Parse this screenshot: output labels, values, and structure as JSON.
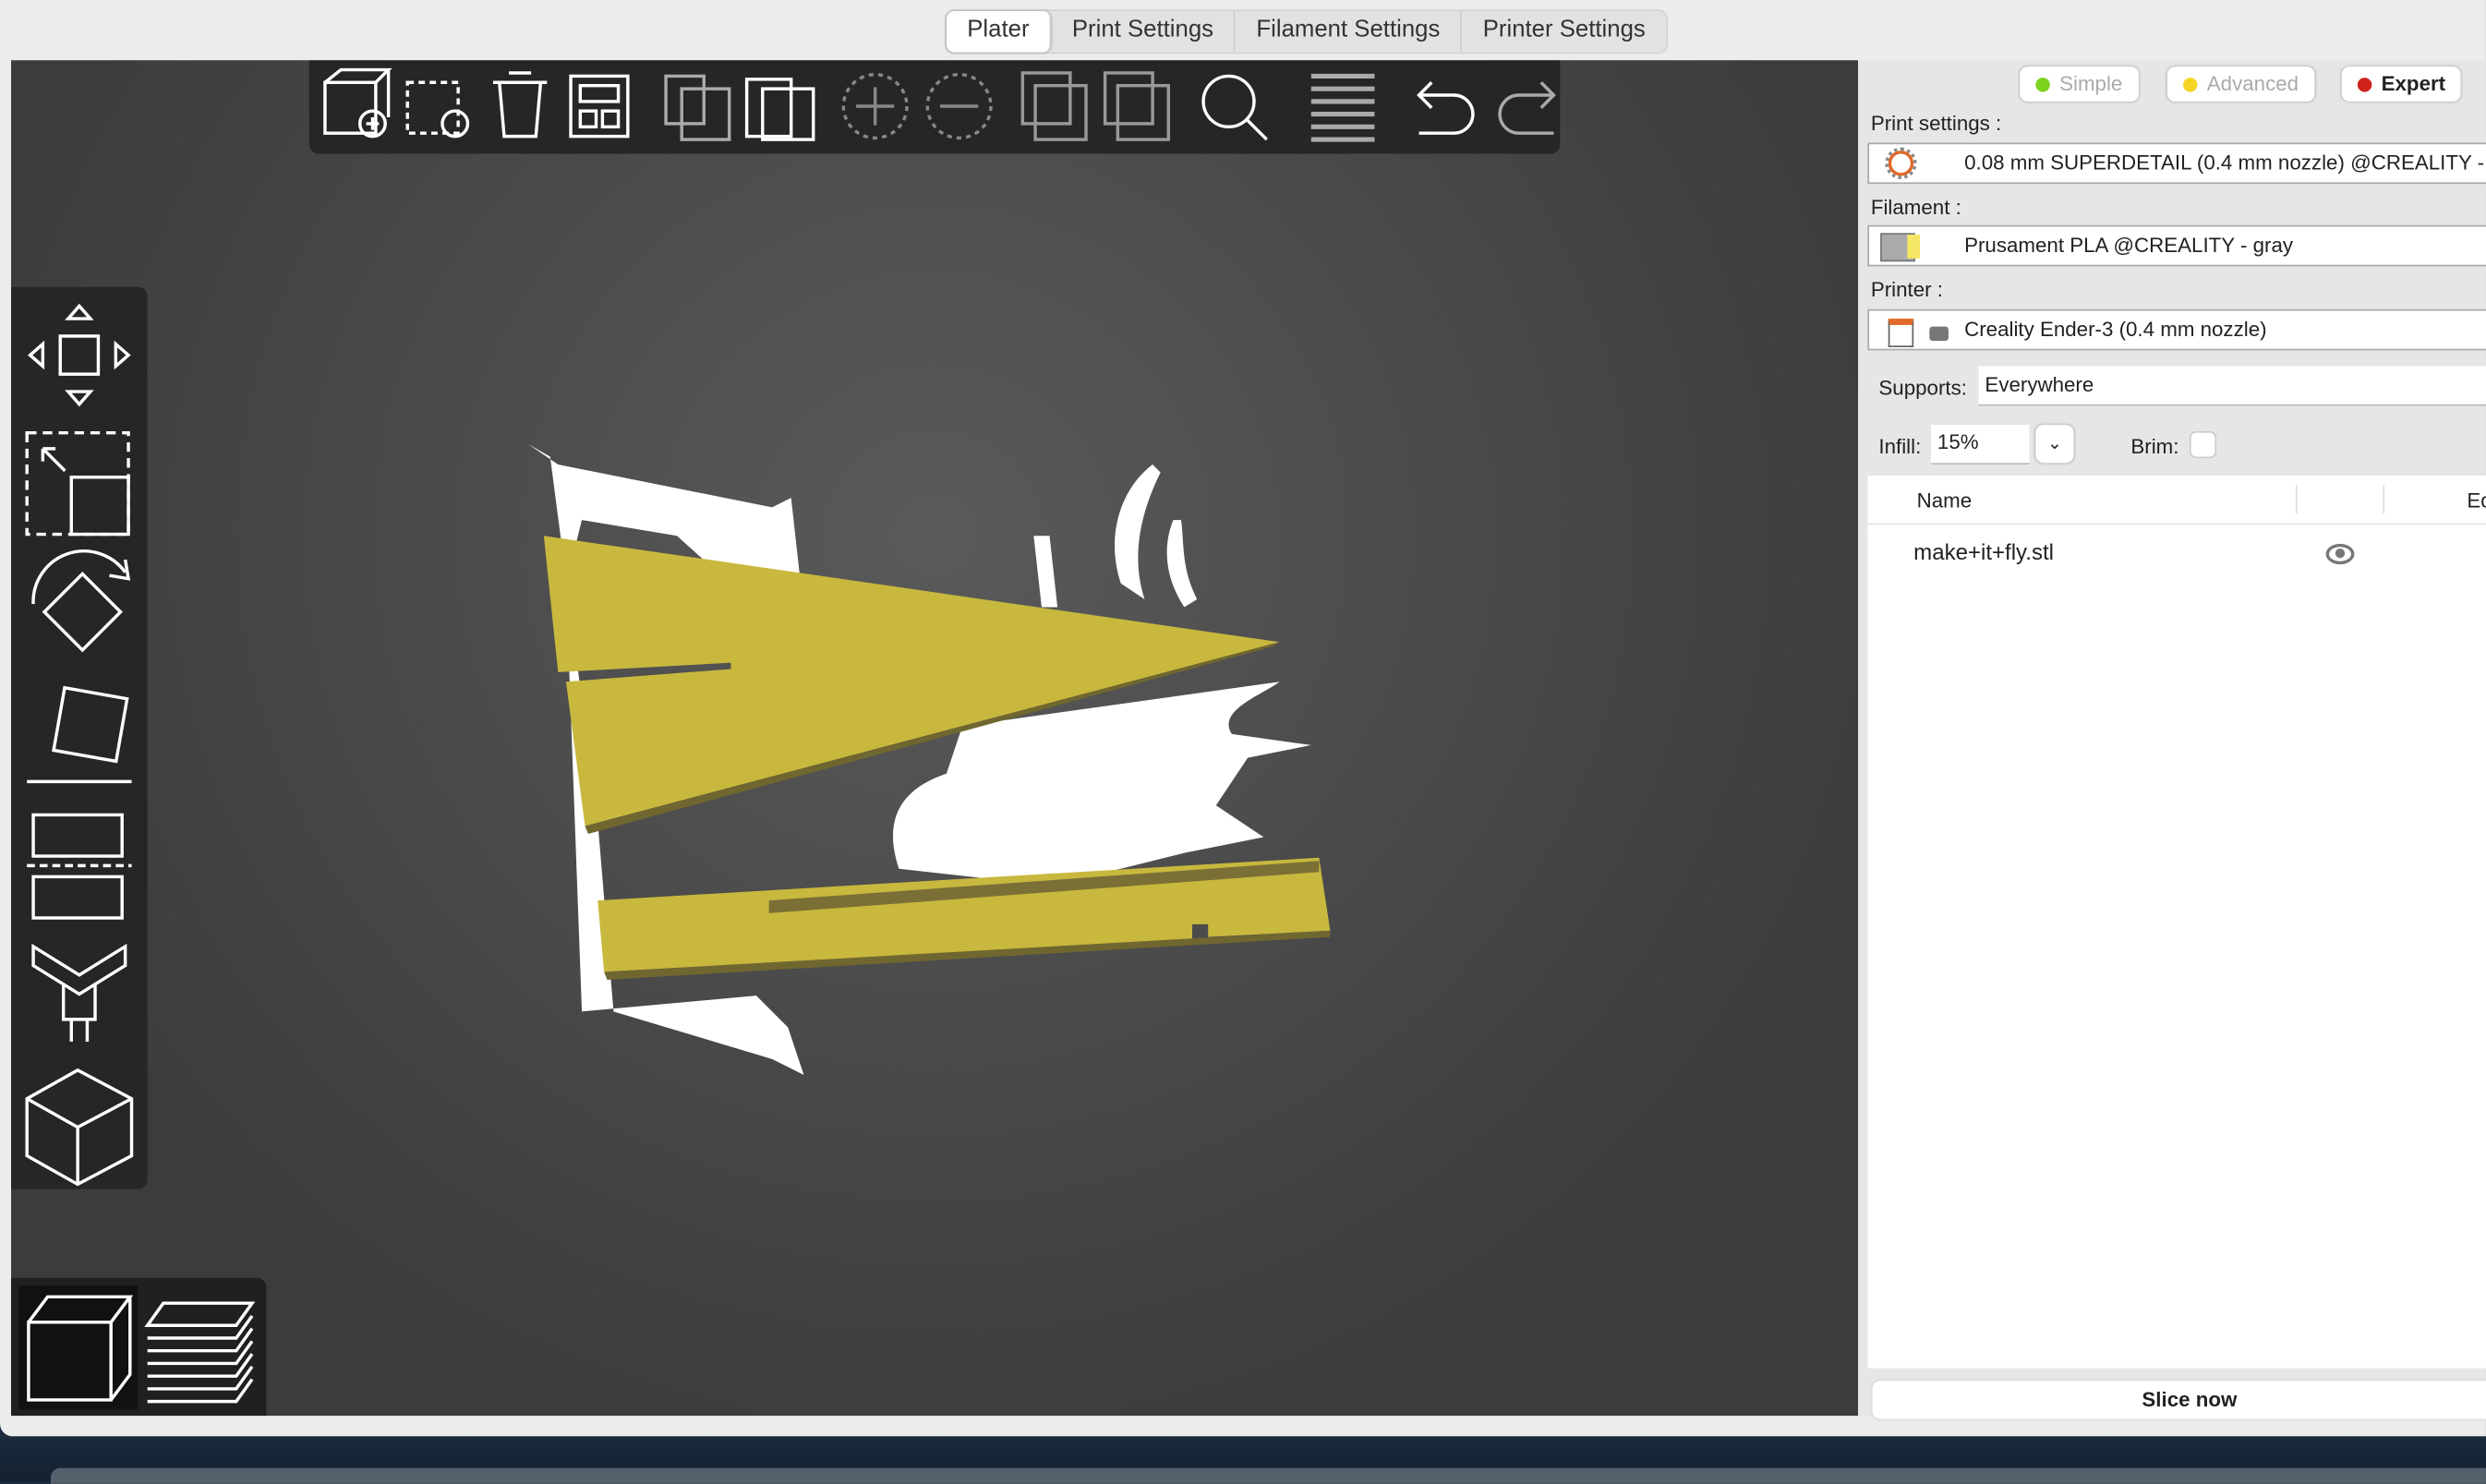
{
  "tabs": [
    {
      "label": "Plater",
      "selected": true
    },
    {
      "label": "Print Settings"
    },
    {
      "label": "Filament Settings"
    },
    {
      "label": "Printer Settings"
    }
  ],
  "toolbar": [
    "add-icon",
    "delete-icon",
    "delete-all-icon",
    "arrange-icon",
    "copy-icon",
    "paste-icon",
    "add-instance-icon",
    "remove-instance-icon",
    "split-objects-icon",
    "split-parts-icon",
    "search-icon",
    "layers-editing-icon",
    "undo-icon",
    "redo-icon"
  ],
  "gizmos": [
    "move-icon",
    "scale-icon",
    "rotate-icon",
    "place-on-face-icon",
    "cut-icon",
    "paint-supports-icon",
    "seam-icon"
  ],
  "view_modes": [
    "3d-view-icon",
    "preview-icon"
  ],
  "panel": {
    "modes": [
      {
        "label": "Simple",
        "color": "#7ed321"
      },
      {
        "label": "Advanced",
        "color": "#f5d524"
      },
      {
        "label": "Expert",
        "color": "#d0231b"
      }
    ],
    "print_settings_label": "Print settings :",
    "print_settings_value": "0.08 mm SUPERDETAIL (0.4 mm nozzle) @CREALITY -",
    "filament_label": "Filament :",
    "filament_value": "Prusament PLA @CREALITY - gray",
    "filament_color": "#f5e663",
    "printer_label": "Printer :",
    "printer_value": "Creality Ender-3 (0.4 mm nozzle)",
    "supports_label": "Supports:",
    "supports_value": "Everywhere",
    "infill_label": "Infill:",
    "infill_value": "15%",
    "brim_label": "Brim:",
    "brim_checked": false,
    "columns": {
      "name": "Name",
      "editing": "Ed"
    },
    "objects": [
      {
        "name": "make+it+fly.stl"
      }
    ],
    "slice_label": "Slice now"
  },
  "model_color": "#c8b83e"
}
